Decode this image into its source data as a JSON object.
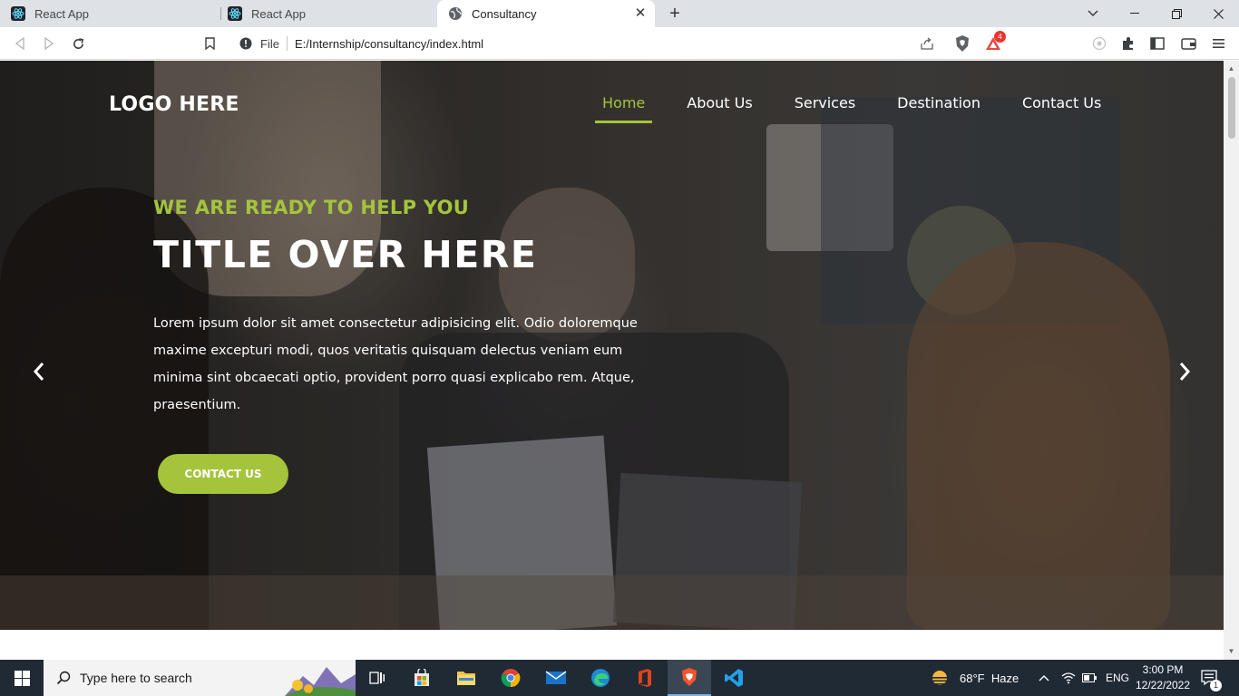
{
  "browser": {
    "tabs": [
      {
        "title": "React App",
        "active": false
      },
      {
        "title": "React App",
        "active": false
      },
      {
        "title": "Consultancy",
        "active": true
      }
    ],
    "new_tab_symbol": "+",
    "url_scheme_label": "File",
    "url": "E:/Internship/consultancy/index.html",
    "brave_rewards_count": "4"
  },
  "page": {
    "logo": "LOGO HERE",
    "nav": [
      "Home",
      "About Us",
      "Services",
      "Destination",
      "Contact Us"
    ],
    "active_nav": "Home",
    "eyebrow": "WE ARE READY TO HELP YOU",
    "title": "TITLE OVER HERE",
    "description": "Lorem ipsum dolor sit amet consectetur adipisicing elit. Odio doloremque maxime excepturi modi, quos veritatis quisquam delectus veniam eum minima sint obcaecati optio, provident porro quasi explicabo rem. Atque, praesentium.",
    "cta": "CONTACT US",
    "accent_color": "#a4c43b"
  },
  "taskbar": {
    "search_placeholder": "Type here to search",
    "weather": "68°F  Haze",
    "language": "ENG",
    "time": "3:00 PM",
    "date": "12/22/2022",
    "notification_count": "1"
  }
}
